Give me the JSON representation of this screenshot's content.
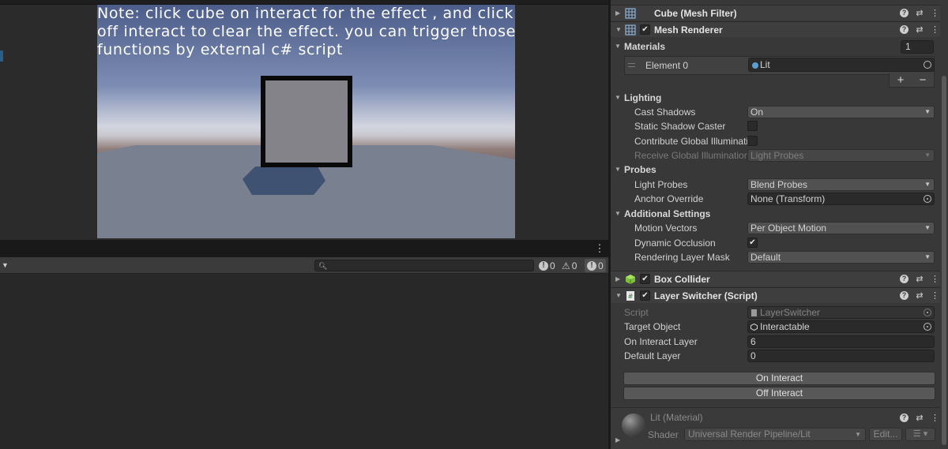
{
  "game": {
    "note": "Note: click cube on interact for the effect , and click off interact to clear the effect. you can trigger those functions by external c# script"
  },
  "console": {
    "menu_icon": "kebab-menu-icon",
    "search": {
      "value": "",
      "placeholder": ""
    },
    "counters": [
      {
        "icon": "info-icon",
        "glyph": "!",
        "count": "0"
      },
      {
        "icon": "warning-icon",
        "glyph": "⚠",
        "count": "0"
      },
      {
        "icon": "error-icon",
        "glyph": "!",
        "count": "0"
      }
    ]
  },
  "inspector": {
    "mesh_filter": {
      "title": "Cube (Mesh Filter)",
      "icon": "grid-icon"
    },
    "mesh_renderer": {
      "title": "Mesh Renderer",
      "icon": "grid-icon",
      "enabled": true,
      "materials": {
        "label": "Materials",
        "count": "1",
        "element_label": "Element 0",
        "element_value": "Lit",
        "add": "+",
        "remove": "−"
      },
      "lighting": {
        "label": "Lighting",
        "cast_shadows": {
          "label": "Cast Shadows",
          "value": "On"
        },
        "static_shadow_caster": {
          "label": "Static Shadow Caster",
          "checked": false
        },
        "contribute_gi": {
          "label": "Contribute Global Illuminati",
          "checked": false
        },
        "receive_gi": {
          "label": "Receive Global Illumination",
          "value": "Light Probes"
        }
      },
      "probes": {
        "label": "Probes",
        "light_probes": {
          "label": "Light Probes",
          "value": "Blend Probes"
        },
        "anchor_override": {
          "label": "Anchor Override",
          "value": "None (Transform)"
        }
      },
      "additional": {
        "label": "Additional Settings",
        "motion_vectors": {
          "label": "Motion Vectors",
          "value": "Per Object Motion"
        },
        "dynamic_occlusion": {
          "label": "Dynamic Occlusion",
          "checked": true
        },
        "rendering_layer_mask": {
          "label": "Rendering Layer Mask",
          "value": "Default"
        }
      }
    },
    "box_collider": {
      "title": "Box Collider",
      "icon": "cube-icon",
      "enabled": true
    },
    "layer_switcher": {
      "title": "Layer Switcher (Script)",
      "icon": "script-icon",
      "enabled": true,
      "script": {
        "label": "Script",
        "value": "LayerSwitcher"
      },
      "target_object": {
        "label": "Target Object",
        "value": "Interactable"
      },
      "on_interact_layer": {
        "label": "On Interact Layer",
        "value": "6"
      },
      "default_layer": {
        "label": "Default Layer",
        "value": "0"
      },
      "on_interact_button": "On Interact",
      "off_interact_button": "Off Interact"
    },
    "material": {
      "title": "Lit (Material)",
      "shader_label": "Shader",
      "shader_value": "Universal Render Pipeline/Lit",
      "edit_label": "Edit...",
      "list_label": "☰"
    },
    "header_icons": {
      "help": "?",
      "settings": "⇄",
      "more": "⋮"
    },
    "checkmark": "✔"
  }
}
